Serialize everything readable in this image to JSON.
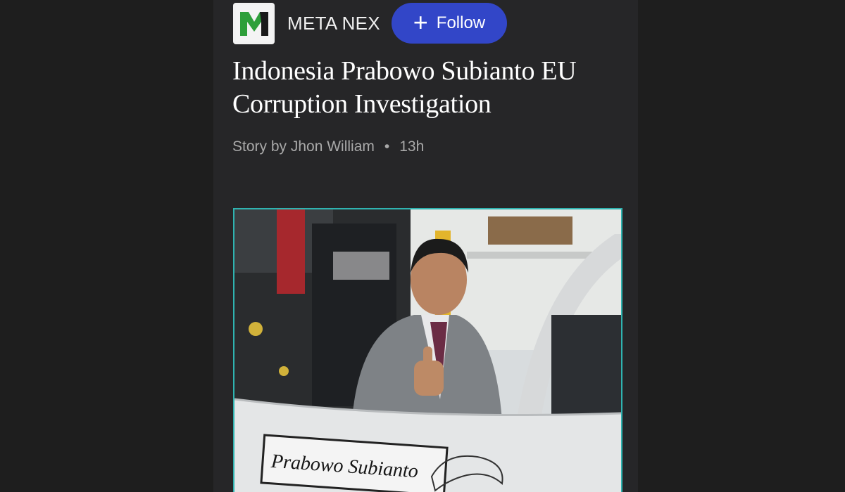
{
  "publisher": {
    "name": "META NEX",
    "logo_letter": "M",
    "follow_label": "Follow"
  },
  "article": {
    "headline": "Indonesia Prabowo Subianto EU Corruption Investigation",
    "byline": "Story by Jhon William",
    "separator": "•",
    "age": "13h"
  },
  "photo": {
    "plate_text": "Prabowo Subianto"
  },
  "colors": {
    "follow_button": "#3246c8",
    "logo_green": "#2e9f3a",
    "photo_border": "#2fb3b0"
  }
}
